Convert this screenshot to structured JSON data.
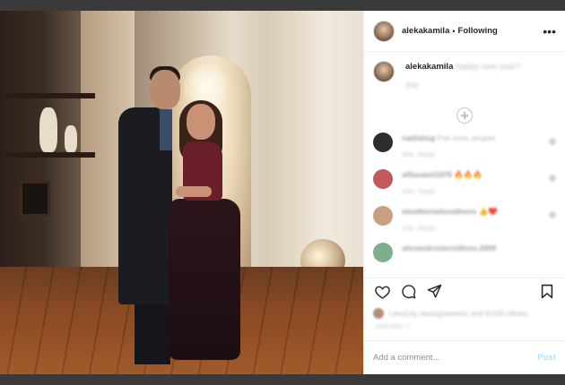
{
  "header": {
    "username": "alekakamila",
    "separator": "•",
    "follow_status": "Following",
    "more_label": "•••"
  },
  "caption": {
    "username": "alekakamila",
    "text": "happy new year!!",
    "meta": "33w"
  },
  "comments": [
    {
      "username": "nadiahsg",
      "text": "Poli ones skrgani",
      "emoji": "",
      "time": "33w",
      "reply": "Reply",
      "avatar_color": "#2d2d2d"
    },
    {
      "username": "alfianaioi1979",
      "text": "",
      "emoji": "🔥🔥🔥",
      "time": "33w",
      "reply": "Reply",
      "avatar_color": "#c25a5a"
    },
    {
      "username": "eleutheriadouathena",
      "text": "",
      "emoji": "👍❤️",
      "time": "33w",
      "reply": "Reply",
      "avatar_color": "#c9a07f"
    },
    {
      "username": "alexandrosterzidisss.2000",
      "text": "",
      "emoji": "",
      "time": "",
      "reply": "",
      "avatar_color": "#7db08a"
    }
  ],
  "likes": {
    "text": "Liked by alexagreleevic and 8,630 others"
  },
  "date": "JANUARY 1",
  "add_comment": {
    "placeholder": "Add a comment...",
    "post_label": "Post"
  },
  "colors": {
    "text_primary": "#262626",
    "text_secondary": "#8e8e8e",
    "post_button_disabled": "#b2dffc",
    "border": "#efefef"
  }
}
